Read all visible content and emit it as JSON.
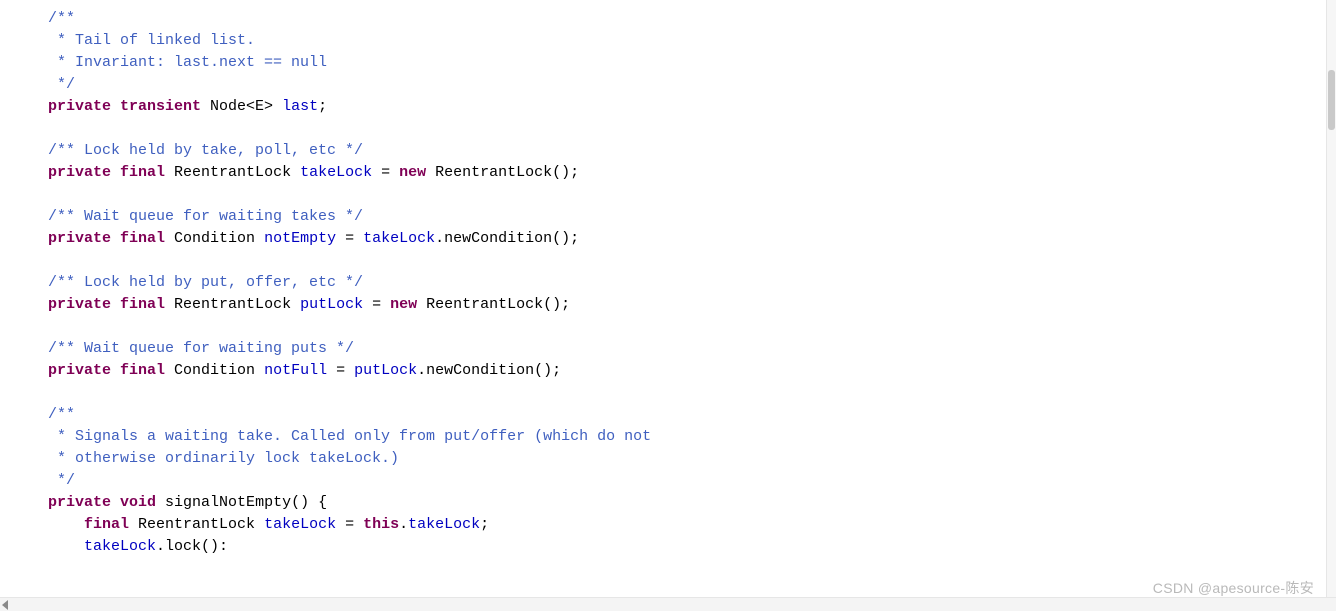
{
  "code": {
    "c01": "/**",
    "c02": " * Tail of linked list.",
    "c03": " * Invariant: last.next == null",
    "c04": " */",
    "kw_private": "private",
    "kw_transient": "transient",
    "kw_final": "final",
    "kw_new": "new",
    "kw_void": "void",
    "kw_this": "this",
    "node_type": " Node<E> ",
    "last": "last",
    "semi": ";",
    "c05": "/** Lock held by take, poll, etc */",
    "rlock": " ReentrantLock ",
    "takeLock": "takeLock",
    "eq": " = ",
    "rlockCtor": " ReentrantLock()",
    "c06": "/** Wait queue for waiting takes */",
    "cond": " Condition ",
    "notEmpty": "notEmpty",
    "newCond": ".newCondition()",
    "c07": "/** Lock held by put, offer, etc */",
    "putLock": "putLock",
    "c08": "/** Wait queue for waiting puts */",
    "notFull": "notFull",
    "c09": "/**",
    "c10": " * Signals a waiting take. Called only from put/offer (which do not",
    "c11": " * otherwise ordinarily lock takeLock.)",
    "c12": " */",
    "sigName": " signalNotEmpty() ",
    "obrace": "{",
    "indent": "    ",
    "dot": ".",
    "t_lockcall": ".lock():"
  },
  "watermark": "CSDN @apesource-陈安"
}
